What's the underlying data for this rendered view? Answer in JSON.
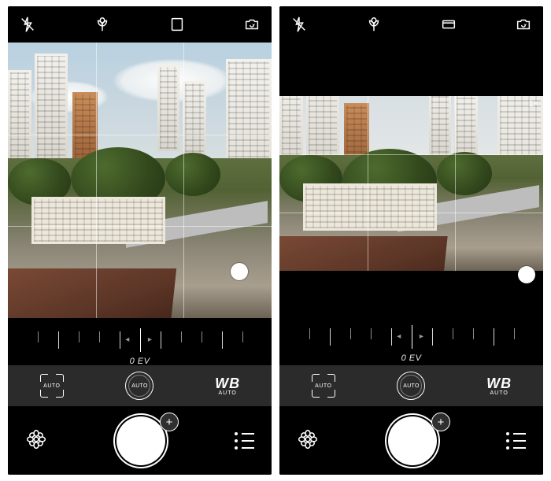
{
  "left": {
    "ev_label": "0 EV",
    "focus_mode": "AUTO",
    "iso_mode": "AUTO",
    "wb_label": "WB",
    "wb_mode": "AUTO",
    "plus": "+"
  },
  "right": {
    "ev_label": "0 EV",
    "zoom_label": "1×",
    "focus_mode": "AUTO",
    "iso_mode": "AUTO",
    "wb_label": "WB",
    "wb_mode": "AUTO",
    "plus": "+"
  }
}
